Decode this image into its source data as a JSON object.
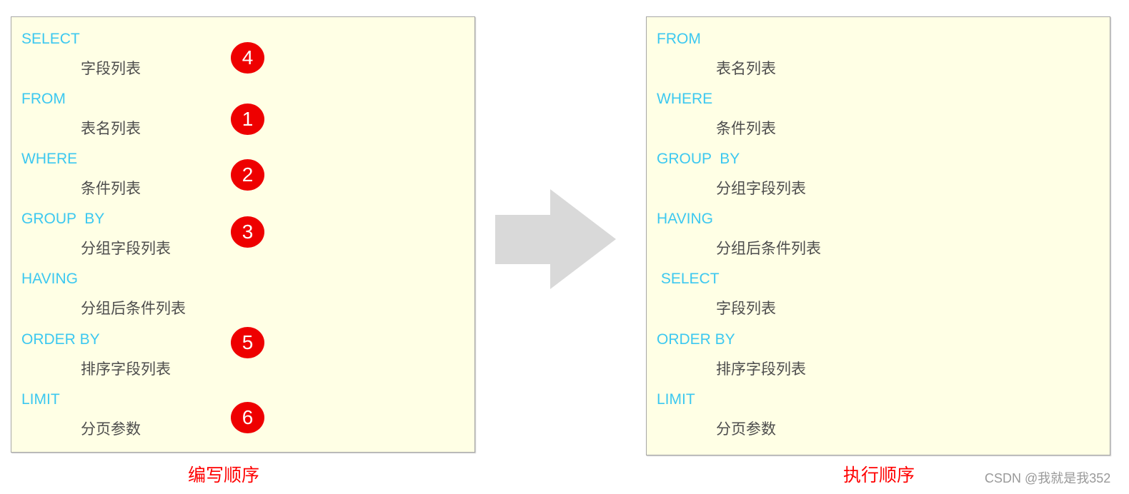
{
  "writing_order": {
    "caption": "编写顺序",
    "clauses": [
      {
        "keyword": "SELECT",
        "argument": "字段列表",
        "step": "4"
      },
      {
        "keyword": "FROM",
        "argument": "表名列表",
        "step": "1"
      },
      {
        "keyword": "WHERE",
        "argument": "条件列表",
        "step": "2"
      },
      {
        "keyword": "GROUP  BY",
        "argument": "分组字段列表",
        "step": "3"
      },
      {
        "keyword": "HAVING",
        "argument": "分组后条件列表",
        "step": ""
      },
      {
        "keyword": "ORDER BY",
        "argument": "排序字段列表",
        "step": "5"
      },
      {
        "keyword": "LIMIT",
        "argument": "分页参数",
        "step": "6"
      }
    ]
  },
  "execution_order": {
    "caption": "执行顺序",
    "clauses": [
      {
        "keyword": "FROM",
        "argument": "表名列表"
      },
      {
        "keyword": "WHERE",
        "argument": "条件列表"
      },
      {
        "keyword": "GROUP  BY",
        "argument": "分组字段列表"
      },
      {
        "keyword": "HAVING",
        "argument": "分组后条件列表"
      },
      {
        "keyword": " SELECT",
        "argument": "字段列表"
      },
      {
        "keyword": "ORDER BY",
        "argument": "排序字段列表"
      },
      {
        "keyword": "LIMIT",
        "argument": "分页参数"
      }
    ]
  },
  "arrow": {
    "icon": "right-arrow-icon",
    "color": "#d9d9d9"
  },
  "colors": {
    "keyword": "#3cc8f0",
    "argument": "#4d4d4d",
    "badge": "#ee0000",
    "caption": "#ff0000",
    "panel": "#ffffe5"
  },
  "watermark": "CSDN @我就是我352"
}
